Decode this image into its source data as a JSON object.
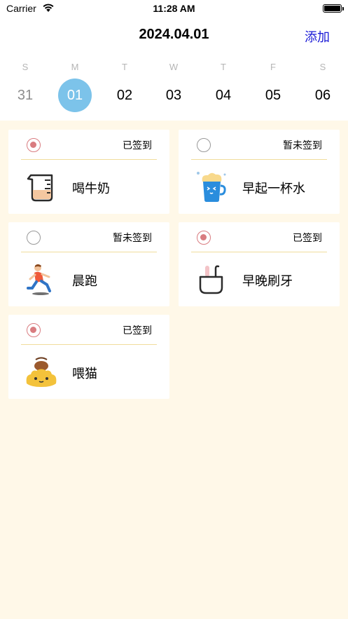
{
  "status_bar": {
    "carrier": "Carrier",
    "time": "11:28 AM"
  },
  "header": {
    "title": "2024.04.01",
    "add_label": "添加"
  },
  "calendar": {
    "weekdays": [
      "S",
      "M",
      "T",
      "W",
      "T",
      "F",
      "S"
    ],
    "days": [
      "31",
      "01",
      "02",
      "03",
      "04",
      "05",
      "06"
    ],
    "selected_day": "01"
  },
  "colors": {
    "accent_blue": "#7cc3ea",
    "link_blue": "#1a1ad6",
    "checked_red": "#d97c80",
    "divider_gold": "#f0dc9c",
    "background": "#fff8e8"
  },
  "tasks": [
    {
      "name": "喝牛奶",
      "status": "已签到",
      "checked": true,
      "icon": "measuring-cup-icon"
    },
    {
      "name": "早起一杯水",
      "status": "暂未签到",
      "checked": false,
      "icon": "water-cup-icon"
    },
    {
      "name": "晨跑",
      "status": "暂未签到",
      "checked": false,
      "icon": "runner-icon"
    },
    {
      "name": "早晚刷牙",
      "status": "已签到",
      "checked": true,
      "icon": "toothbrush-cup-icon"
    },
    {
      "name": "喂猫",
      "status": "已签到",
      "checked": true,
      "icon": "cat-food-icon"
    }
  ]
}
